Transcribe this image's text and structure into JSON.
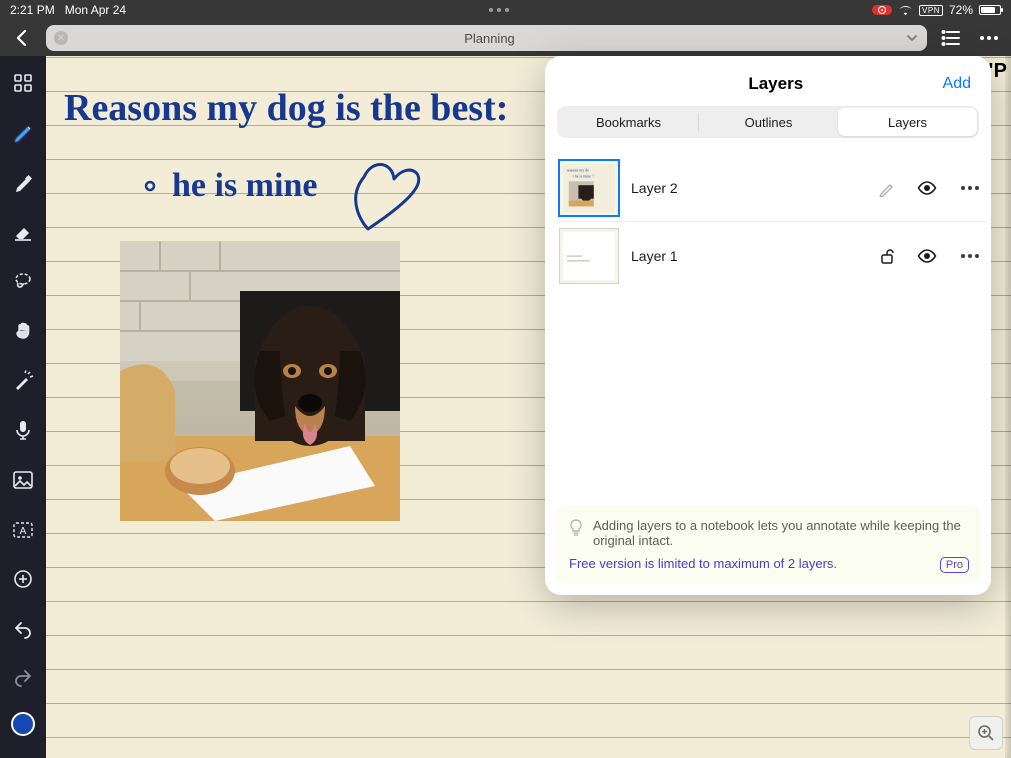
{
  "status": {
    "time": "2:21 PM",
    "date": "Mon Apr 24",
    "vpn_label": "VPN",
    "battery_pct_label": "72%",
    "battery_fill_pct": 72
  },
  "nav": {
    "doc_title": "Planning",
    "page_corner_partial": "\"P"
  },
  "toolbar": {
    "tools": [
      {
        "name": "apps-grid-icon"
      },
      {
        "name": "pen-icon",
        "active": true
      },
      {
        "name": "highlighter-icon"
      },
      {
        "name": "eraser-icon"
      },
      {
        "name": "lasso-icon"
      },
      {
        "name": "hand-pan-icon"
      },
      {
        "name": "laser-pointer-icon"
      },
      {
        "name": "microphone-icon"
      },
      {
        "name": "image-icon"
      },
      {
        "name": "text-box-icon"
      },
      {
        "name": "add-shape-icon"
      }
    ],
    "undo": "undo-icon",
    "redo": "redo-icon",
    "color_swatch_hex": "#1746b5"
  },
  "note": {
    "line1": "Reasons my dog is the best:",
    "line2": "he is mine",
    "photo_alt": "dog-with-pastry-photo"
  },
  "panel": {
    "title": "Layers",
    "add_label": "Add",
    "tabs": {
      "bookmarks": "Bookmarks",
      "outlines": "Outlines",
      "layers": "Layers",
      "selected": "layers"
    },
    "layers": [
      {
        "name": "Layer 2",
        "selected": true,
        "pencil": true,
        "lock": false,
        "visible": true
      },
      {
        "name": "Layer 1",
        "selected": false,
        "pencil": false,
        "lock": true,
        "visible": true
      }
    ],
    "tip_text": "Adding layers to a notebook lets you annotate while keeping the original intact.",
    "limit_text": "Free version is limited to maximum of 2 layers.",
    "pro_label": "Pro"
  }
}
